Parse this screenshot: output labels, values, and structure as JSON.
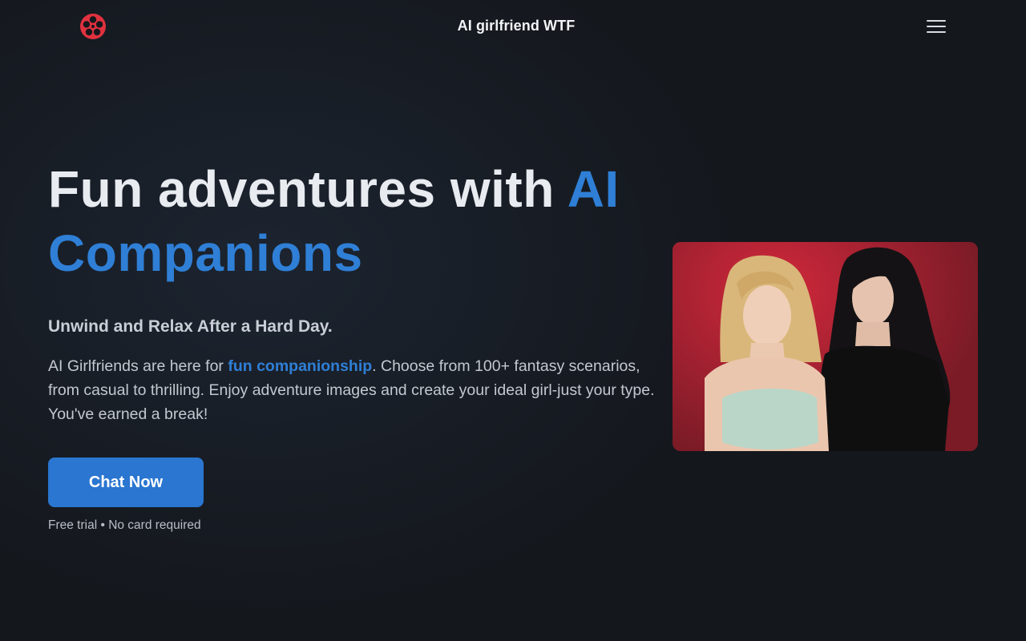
{
  "header": {
    "logo_icon": "film-reel-icon",
    "logo_color": "#e0313f",
    "title": "AI girlfriend WTF",
    "menu_icon": "hamburger-menu-icon"
  },
  "hero": {
    "headline_part1": "Fun adventures with ",
    "headline_accent": "AI Companions",
    "accent_color": "#2f7fd6",
    "subheading": "Unwind and Relax After a Hard Day.",
    "description_before": "AI Girlfriends are here for ",
    "description_highlight": "fun companionship",
    "description_after": ". Choose from 100+ fantasy scenarios, from casual to thrilling. Enjoy adventure images and create your ideal girl-just your type. You've earned a break!",
    "cta_label": "Chat Now",
    "cta_color": "#2a76d0",
    "cta_note": "Free trial • No card required"
  },
  "image": {
    "description_icon": "companions-photo",
    "background_color": "#a92232"
  }
}
